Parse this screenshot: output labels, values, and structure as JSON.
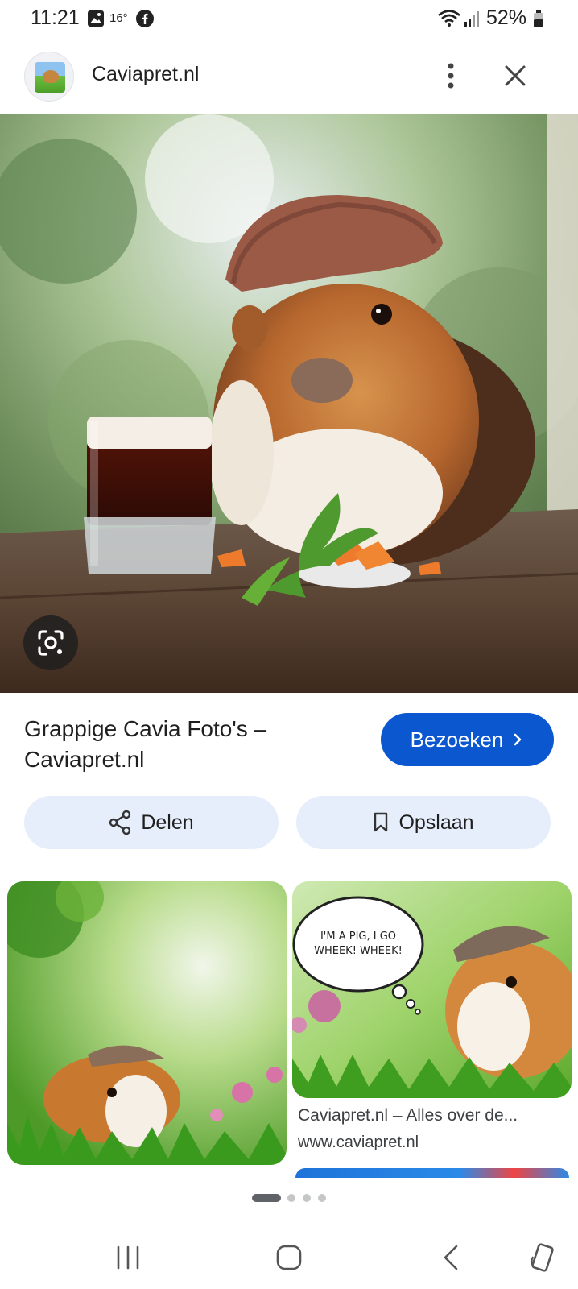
{
  "status_bar": {
    "time": "11:21",
    "temperature": "16°",
    "battery": "52%"
  },
  "header": {
    "site_name": "Caviapret.nl",
    "menu_icon": "more-vert-icon",
    "close_icon": "close-icon"
  },
  "main_image": {
    "lens_icon": "lens-icon"
  },
  "result": {
    "title": "Grappige Cavia Foto's – Caviapret.nl",
    "visit_label": "Bezoeken"
  },
  "actions": {
    "share_label": "Delen",
    "save_label": "Opslaan"
  },
  "related": [
    {
      "title": "",
      "source": ""
    },
    {
      "title": "Caviapret.nl – Alles over de...",
      "source": "www.caviapret.nl",
      "bubble_text": "I'M A PIG, I GO WHEEK! WHEEK!"
    }
  ],
  "pagination": {
    "total": 4,
    "active": 1
  },
  "colors": {
    "accent": "#0b57d0",
    "chip_bg": "#e6eefc"
  }
}
